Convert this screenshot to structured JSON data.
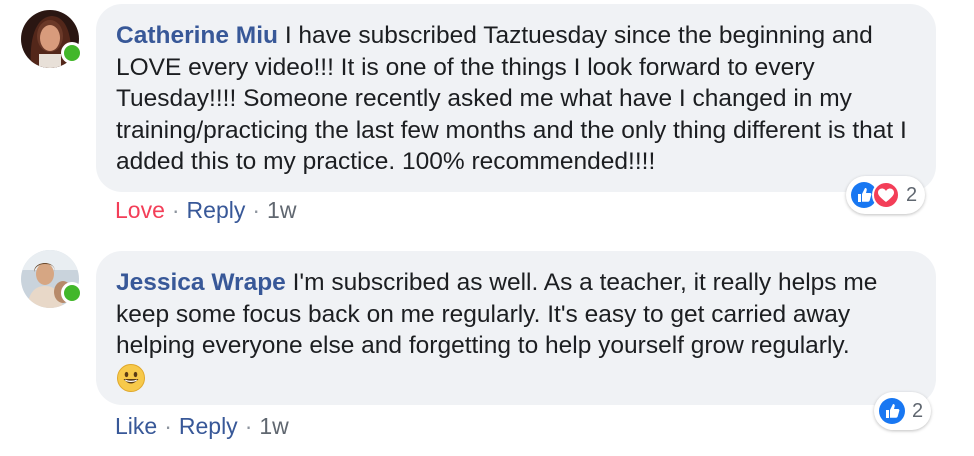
{
  "comments": [
    {
      "author": "Catherine Miu",
      "text": "I have subscribed Taztuesday since the beginning and LOVE every video!!! It is one of the things I look forward to every Tuesday!!!! Someone recently asked me what have I changed in my training/practicing the last few months and the only thing different is that I added this to my practice. 100% recommended!!!!",
      "action_reaction": "Love",
      "action_reply": "Reply",
      "separator": "·",
      "time": "1w",
      "reaction_count": "2",
      "reactions": [
        "like-icon",
        "love-icon"
      ],
      "online": true
    },
    {
      "author": "Jessica Wrape",
      "text": "I'm subscribed as well. As a teacher, it really helps me keep some focus back on me regularly. It's easy to get carried away helping everyone else and forgetting to help yourself grow regularly.",
      "emoji": "grinning-face-emoji",
      "action_reaction": "Like",
      "action_reply": "Reply",
      "separator": "·",
      "time": "1w",
      "reaction_count": "2",
      "reactions": [
        "like-icon"
      ],
      "online": true
    }
  ],
  "colors": {
    "author_link": "#385898",
    "love": "#f33e58",
    "like_blue": "#1877f2",
    "bubble_bg": "#f0f2f5",
    "online": "#42b72a"
  }
}
